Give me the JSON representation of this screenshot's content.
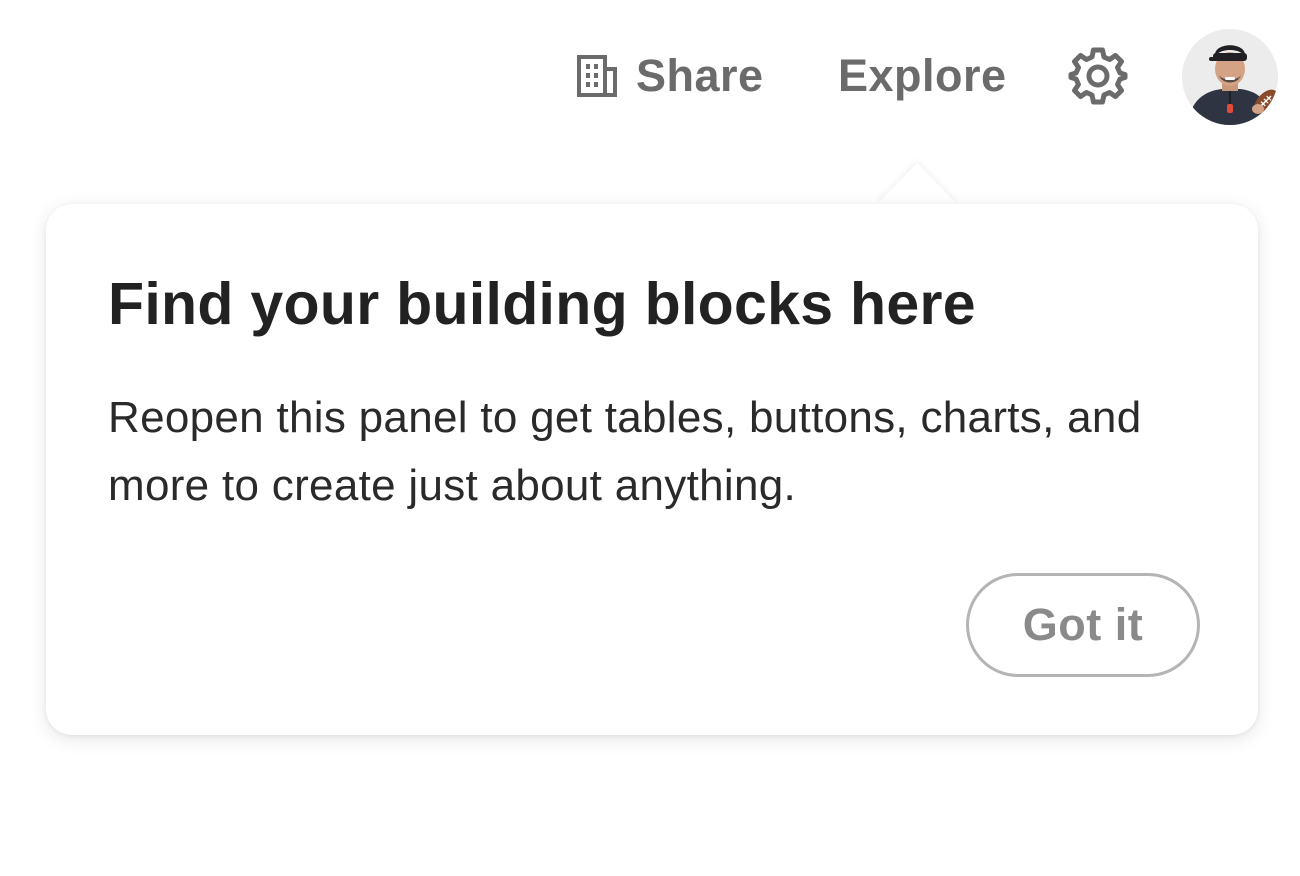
{
  "header": {
    "share_label": "Share",
    "share_icon": "building-icon",
    "explore_label": "Explore",
    "settings_icon": "gear-icon",
    "avatar_icon": "user-avatar"
  },
  "popover": {
    "title": "Find your building blocks here",
    "body": "Reopen this panel to get tables, buttons, charts, and more to create just about anything.",
    "dismiss_label": "Got it"
  },
  "colors": {
    "nav_text": "#6b6b6b",
    "title_text": "#222222",
    "body_text": "#2a2a2a",
    "button_border": "#b4b4b4",
    "button_text": "#8a8a8a"
  }
}
